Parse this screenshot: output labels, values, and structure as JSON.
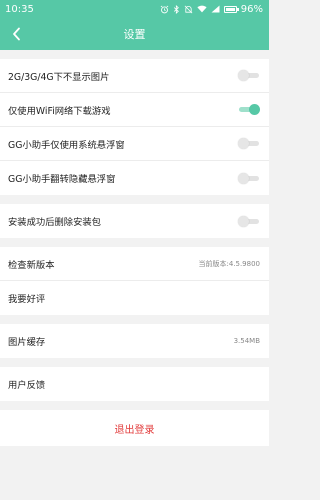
{
  "status_bar": {
    "time": "10:35",
    "battery": "96%"
  },
  "header": {
    "title": "设置"
  },
  "toggles": [
    {
      "label": "2G/3G/4G下不显示图片",
      "on": false
    },
    {
      "label": "仅使用WiFi网络下载游戏",
      "on": true
    },
    {
      "label": "GG小助手仅使用系统悬浮窗",
      "on": false
    },
    {
      "label": "GG小助手翻转隐藏悬浮窗",
      "on": false
    }
  ],
  "install_cleanup": {
    "label": "安装成功后删除安装包",
    "on": false
  },
  "info_items": [
    {
      "label": "检查新版本",
      "value": "当前版本:4.5.9800"
    },
    {
      "label": "我要好评",
      "value": ""
    }
  ],
  "cache": {
    "label": "图片缓存",
    "value": "3.54MB"
  },
  "feedback": {
    "label": "用户反馈"
  },
  "logout": {
    "label": "退出登录"
  },
  "colors": {
    "accent": "#56c8a6",
    "danger": "#e23b3b"
  }
}
